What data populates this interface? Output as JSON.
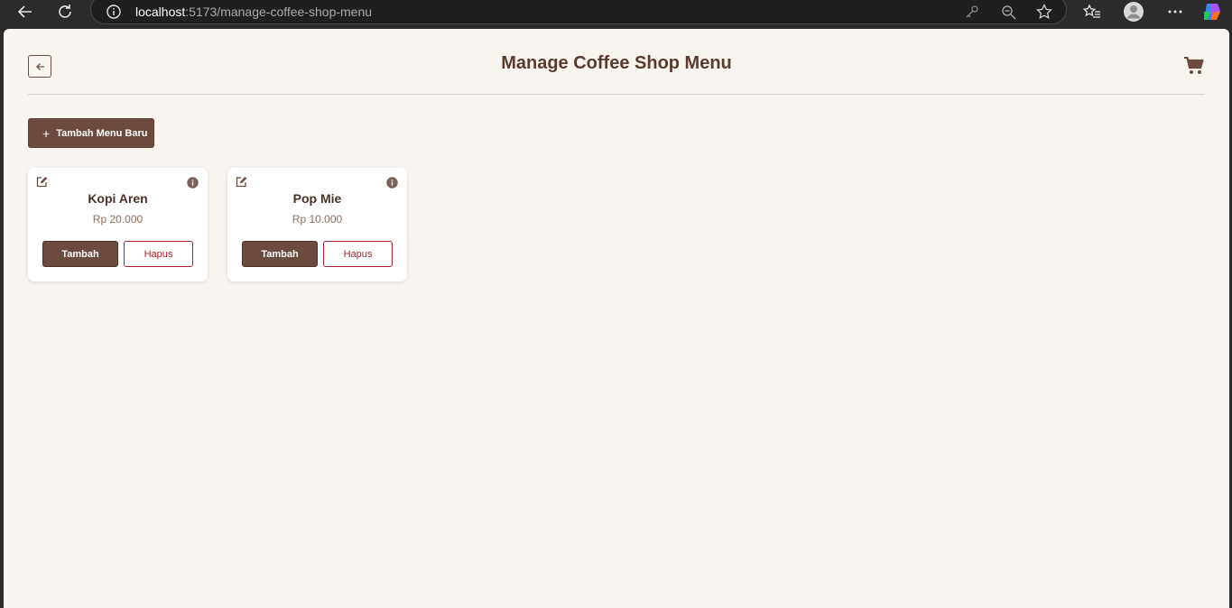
{
  "browser": {
    "url_host": "localhost",
    "url_rest": ":5173/manage-coffee-shop-menu",
    "icons": [
      "back-arrow-icon",
      "reload-icon",
      "info-icon",
      "key-icon",
      "zoom-out-icon",
      "star-icon",
      "favorites-icon",
      "profile-icon",
      "more-icon",
      "copilot-icon"
    ]
  },
  "header": {
    "title": "Manage Coffee Shop Menu",
    "back_icon": "arrow-left-icon",
    "cart_icon": "cart-icon"
  },
  "add_button": {
    "icon": "+",
    "label": "Tambah Menu Baru"
  },
  "menu_items": [
    {
      "name": "Kopi Aren",
      "price": "Rp 20.000",
      "add_label": "Tambah",
      "delete_label": "Hapus"
    },
    {
      "name": "Pop Mie",
      "price": "Rp 10.000",
      "add_label": "Tambah",
      "delete_label": "Hapus"
    }
  ],
  "colors": {
    "brand": "#6b4a3f",
    "title": "#5b3a2e",
    "danger": "#b0202a",
    "page_bg": "#f8f5f1"
  }
}
